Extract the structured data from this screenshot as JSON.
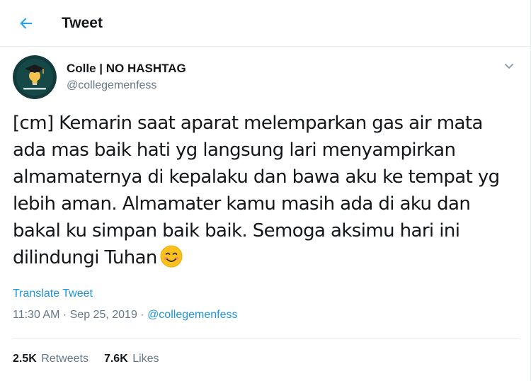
{
  "header": {
    "title": "Tweet",
    "back_icon": "arrow-left-icon",
    "accent": "#1da1f2"
  },
  "author": {
    "name": "Colle | NO HASHTAG",
    "handle": "@collegemenfess",
    "avatar_bg": "#123b3b",
    "avatar_icon": "graduation-cap-lightbulb-icon"
  },
  "tweet": {
    "lines": [
      "[cm] Kemarin saat aparat melemparkan gas air mata",
      "ada mas baik hati yg langsung lari menyampirkan",
      "almamaternya di kepalaku dan bawa aku ke tempat yg",
      "lebih aman. Almamater kamu masih ada di aku dan",
      "bakal ku simpan baik baik. Semoga aksimu hari ini",
      "dilindungi Tuhan"
    ],
    "emoji": "smiling-face-with-smiling-eyes"
  },
  "translate_label": "Translate Tweet",
  "meta": {
    "time": "11:30 AM",
    "separator1": " · ",
    "date": "Sep 25, 2019",
    "separator2": " · ",
    "via": "@collegemenfess"
  },
  "stats": {
    "retweets_count": "2.5K",
    "retweets_label": "Retweets",
    "likes_count": "7.6K",
    "likes_label": "Likes"
  },
  "colors": {
    "link": "#1b95e0",
    "secondary_text": "#657786",
    "border": "#e6ecf0"
  }
}
